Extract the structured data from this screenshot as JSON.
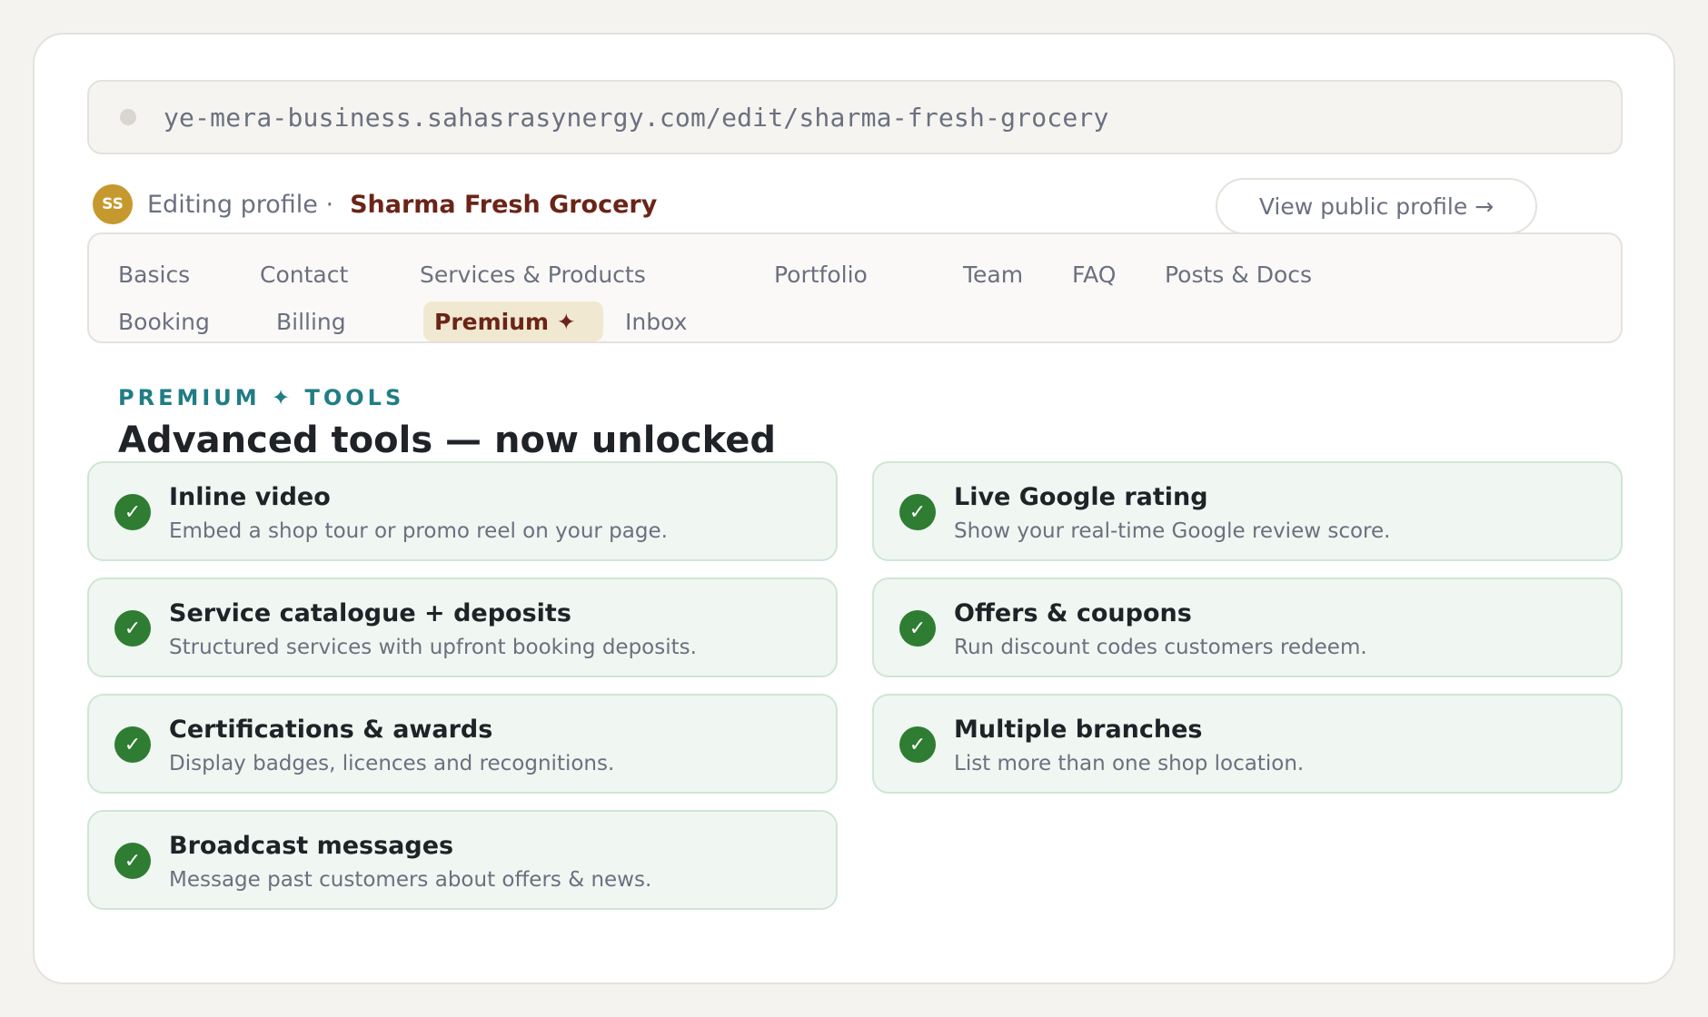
{
  "browser": {
    "url": "ye-mera-business.sahasrasynergy.com/edit/sharma-fresh-grocery"
  },
  "header": {
    "avatar_initials": "SS",
    "editing_label": "Editing profile ·",
    "business_name": "Sharma Fresh Grocery",
    "view_public_label": "View public profile →"
  },
  "tabs": [
    {
      "label": "Basics"
    },
    {
      "label": "Contact"
    },
    {
      "label": "Services & Products"
    },
    {
      "label": "Portfolio"
    },
    {
      "label": "Team"
    },
    {
      "label": "FAQ"
    },
    {
      "label": "Posts & Docs"
    },
    {
      "label": "Booking"
    },
    {
      "label": "Billing"
    },
    {
      "label": "Premium ✦",
      "active": true
    },
    {
      "label": "Inbox"
    }
  ],
  "section": {
    "kicker": "PREMIUM ✦ TOOLS",
    "title": "Advanced tools — now unlocked"
  },
  "features": [
    {
      "title": "Inline video",
      "desc": "Embed a shop tour or promo reel on your page."
    },
    {
      "title": "Live Google rating",
      "desc": "Show your real-time Google review score."
    },
    {
      "title": "Service catalogue + deposits",
      "desc": "Structured services with upfront booking deposits."
    },
    {
      "title": "Offers & coupons",
      "desc": "Run discount codes customers redeem."
    },
    {
      "title": "Certifications & awards",
      "desc": "Display badges, licences and recognitions."
    },
    {
      "title": "Multiple branches",
      "desc": "List more than one shop location."
    },
    {
      "title": "Broadcast messages",
      "desc": "Message past customers about offers & news."
    }
  ],
  "icons": {
    "check": "check-circle-icon",
    "url_dot": "page-dot-icon"
  },
  "colors": {
    "accent": "#6b2418",
    "kicker": "#217d85",
    "check": "#2e7d32",
    "avatar": "#c6992e"
  }
}
